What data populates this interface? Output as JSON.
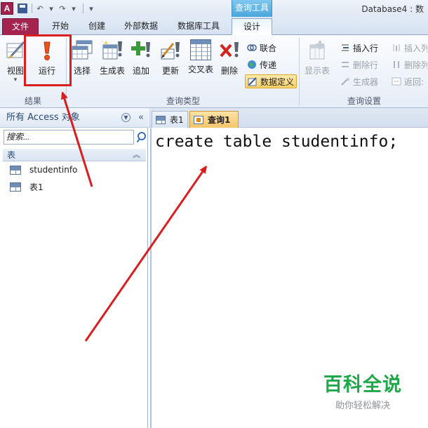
{
  "titlebar": {
    "app_logo": "A",
    "context_group": "查询工具",
    "window_title": "Database4 : 数"
  },
  "ribbon_tabs": [
    {
      "label": "文件"
    },
    {
      "label": "开始"
    },
    {
      "label": "创建"
    },
    {
      "label": "外部数据"
    },
    {
      "label": "数据库工具"
    },
    {
      "label": "设计"
    }
  ],
  "ribbon": {
    "results_group": {
      "label": "结果",
      "view": "视图",
      "run": "运行"
    },
    "query_type_group": {
      "label": "查询类型",
      "select": "选择",
      "make_table": "生成表",
      "append": "追加",
      "update": "更新",
      "crosstab": "交叉表",
      "delete": "删除",
      "union": "联合",
      "pass_through": "传递",
      "data_definition": "数据定义"
    },
    "query_setup_group": {
      "label": "查询设置",
      "show_table": "显示表",
      "insert_rows": "插入行",
      "delete_rows": "删除行",
      "builder": "生成器",
      "insert_columns": "插入列",
      "delete_columns": "删除列",
      "return": "返回:"
    },
    "colors": {
      "file_tab": "#a5234f",
      "run_icon": "#e8541a",
      "annotation_red": "#d81e1e",
      "context_tab": "#4aa6dd"
    }
  },
  "nav_pane": {
    "header": "所有 Access 对象",
    "search_placeholder": "搜索...",
    "group_label": "表",
    "items": [
      {
        "label": "studentinfo",
        "icon": "table-icon"
      },
      {
        "label": "表1",
        "icon": "table-icon"
      }
    ]
  },
  "document": {
    "tabs": [
      {
        "label": "表1",
        "icon": "table-icon",
        "active": false
      },
      {
        "label": "查询1",
        "icon": "query-icon",
        "active": true
      }
    ],
    "sql": "create table studentinfo;"
  },
  "watermark": {
    "main": "百科全说",
    "sub": "助你轻松解决"
  }
}
